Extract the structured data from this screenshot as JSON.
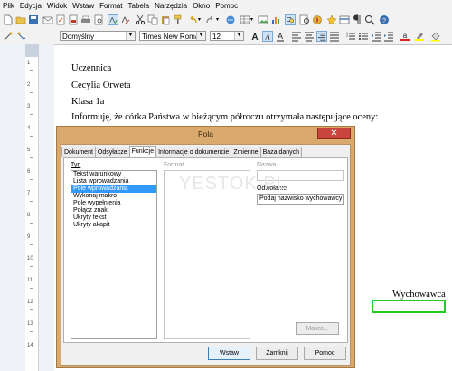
{
  "menu": [
    "Plik",
    "Edycja",
    "Widok",
    "Wstaw",
    "Format",
    "Tabela",
    "Narzędzia",
    "Okno",
    "Pomoc"
  ],
  "formatting": {
    "style": "Domyślny",
    "font": "Times New Roman",
    "size": "12"
  },
  "ruler": {
    "numbers": [
      "1",
      "2",
      "3",
      "4",
      "5",
      "6",
      "7",
      "8",
      "9",
      "10",
      "11",
      "12",
      "13",
      "14"
    ]
  },
  "document": {
    "lines": [
      "Uczennica",
      "Cecylia  Orweta",
      "Klasa 1a",
      "Informuję, że córka Państwa  w bieżącym półroczu otrzymała następujące oceny:"
    ],
    "signature": "Wychowawca"
  },
  "dialog": {
    "title": "Pola",
    "close": "✕",
    "tabs": [
      "Dokument",
      "Odsyłacze",
      "Funkcje",
      "Informacje o dokumencie",
      "Zmienne",
      "Baza danych"
    ],
    "active_tab": "Funkcje",
    "type_label": "Typ",
    "format_label": "Format",
    "name_label": "Nazwa",
    "value_label": "Odwołanie",
    "types": [
      "Tekst warunkowy",
      "Lista wprowadzania",
      "Pole wprowadzania",
      "Wykonaj makro",
      "Pole wypełnienia",
      "Połącz znaki",
      "Ukryty tekst",
      "Ukryty akapit"
    ],
    "selected_type": "Pole wprowadzania",
    "name_value": "",
    "reference_value": "Podaj nazwisko wychowawcy",
    "macro_button": "Makro...",
    "insert_button": "Wstaw",
    "close_button": "Zamknij",
    "help_button": "Pomoc"
  },
  "watermark": "YESTOK.PL"
}
